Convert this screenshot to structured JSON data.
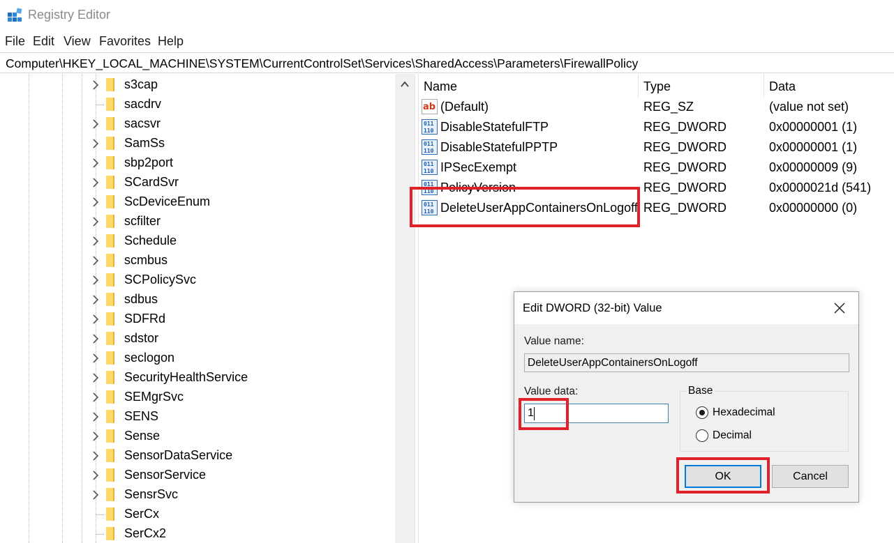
{
  "window": {
    "title": "Registry Editor",
    "icon": "registry-icon"
  },
  "menu": [
    "File",
    "Edit",
    "View",
    "Favorites",
    "Help"
  ],
  "address": "Computer\\HKEY_LOCAL_MACHINE\\SYSTEM\\CurrentControlSet\\Services\\SharedAccess\\Parameters\\FirewallPolicy",
  "tree": [
    {
      "label": "s3cap",
      "expandable": true
    },
    {
      "label": "sacdrv",
      "expandable": false
    },
    {
      "label": "sacsvr",
      "expandable": true
    },
    {
      "label": "SamSs",
      "expandable": true
    },
    {
      "label": "sbp2port",
      "expandable": true
    },
    {
      "label": "SCardSvr",
      "expandable": true
    },
    {
      "label": "ScDeviceEnum",
      "expandable": true
    },
    {
      "label": "scfilter",
      "expandable": true
    },
    {
      "label": "Schedule",
      "expandable": true
    },
    {
      "label": "scmbus",
      "expandable": true
    },
    {
      "label": "SCPolicySvc",
      "expandable": true
    },
    {
      "label": "sdbus",
      "expandable": true
    },
    {
      "label": "SDFRd",
      "expandable": true
    },
    {
      "label": "sdstor",
      "expandable": true
    },
    {
      "label": "seclogon",
      "expandable": true
    },
    {
      "label": "SecurityHealthService",
      "expandable": true
    },
    {
      "label": "SEMgrSvc",
      "expandable": true
    },
    {
      "label": "SENS",
      "expandable": true
    },
    {
      "label": "Sense",
      "expandable": true
    },
    {
      "label": "SensorDataService",
      "expandable": true
    },
    {
      "label": "SensorService",
      "expandable": true
    },
    {
      "label": "SensrSvc",
      "expandable": true
    },
    {
      "label": "SerCx",
      "expandable": false
    },
    {
      "label": "SerCx2",
      "expandable": false
    }
  ],
  "columns": {
    "name": "Name",
    "type": "Type",
    "data": "Data"
  },
  "values": [
    {
      "name": "(Default)",
      "type": "REG_SZ",
      "data": "(value not set)",
      "icon": "string-value-icon"
    },
    {
      "name": "DisableStatefulFTP",
      "type": "REG_DWORD",
      "data": "0x00000001 (1)",
      "icon": "dword-value-icon"
    },
    {
      "name": "DisableStatefulPPTP",
      "type": "REG_DWORD",
      "data": "0x00000001 (1)",
      "icon": "dword-value-icon"
    },
    {
      "name": "IPSecExempt",
      "type": "REG_DWORD",
      "data": "0x00000009 (9)",
      "icon": "dword-value-icon"
    },
    {
      "name": "PolicyVersion",
      "type": "REG_DWORD",
      "data": "0x0000021d (541)",
      "icon": "dword-value-icon"
    },
    {
      "name": "DeleteUserAppContainersOnLogoff",
      "type": "REG_DWORD",
      "data": "0x00000000 (0)",
      "icon": "dword-value-icon"
    }
  ],
  "dialog": {
    "title": "Edit DWORD (32-bit) Value",
    "value_name_label": "Value name:",
    "value_name": "DeleteUserAppContainersOnLogoff",
    "value_data_label": "Value data:",
    "value_data": "1",
    "base_label": "Base",
    "base_options": [
      {
        "label": "Hexadecimal",
        "selected": true
      },
      {
        "label": "Decimal",
        "selected": false
      }
    ],
    "ok_label": "OK",
    "cancel_label": "Cancel"
  },
  "colors": {
    "highlight": "#e0202a",
    "focus": "#0078d7"
  }
}
